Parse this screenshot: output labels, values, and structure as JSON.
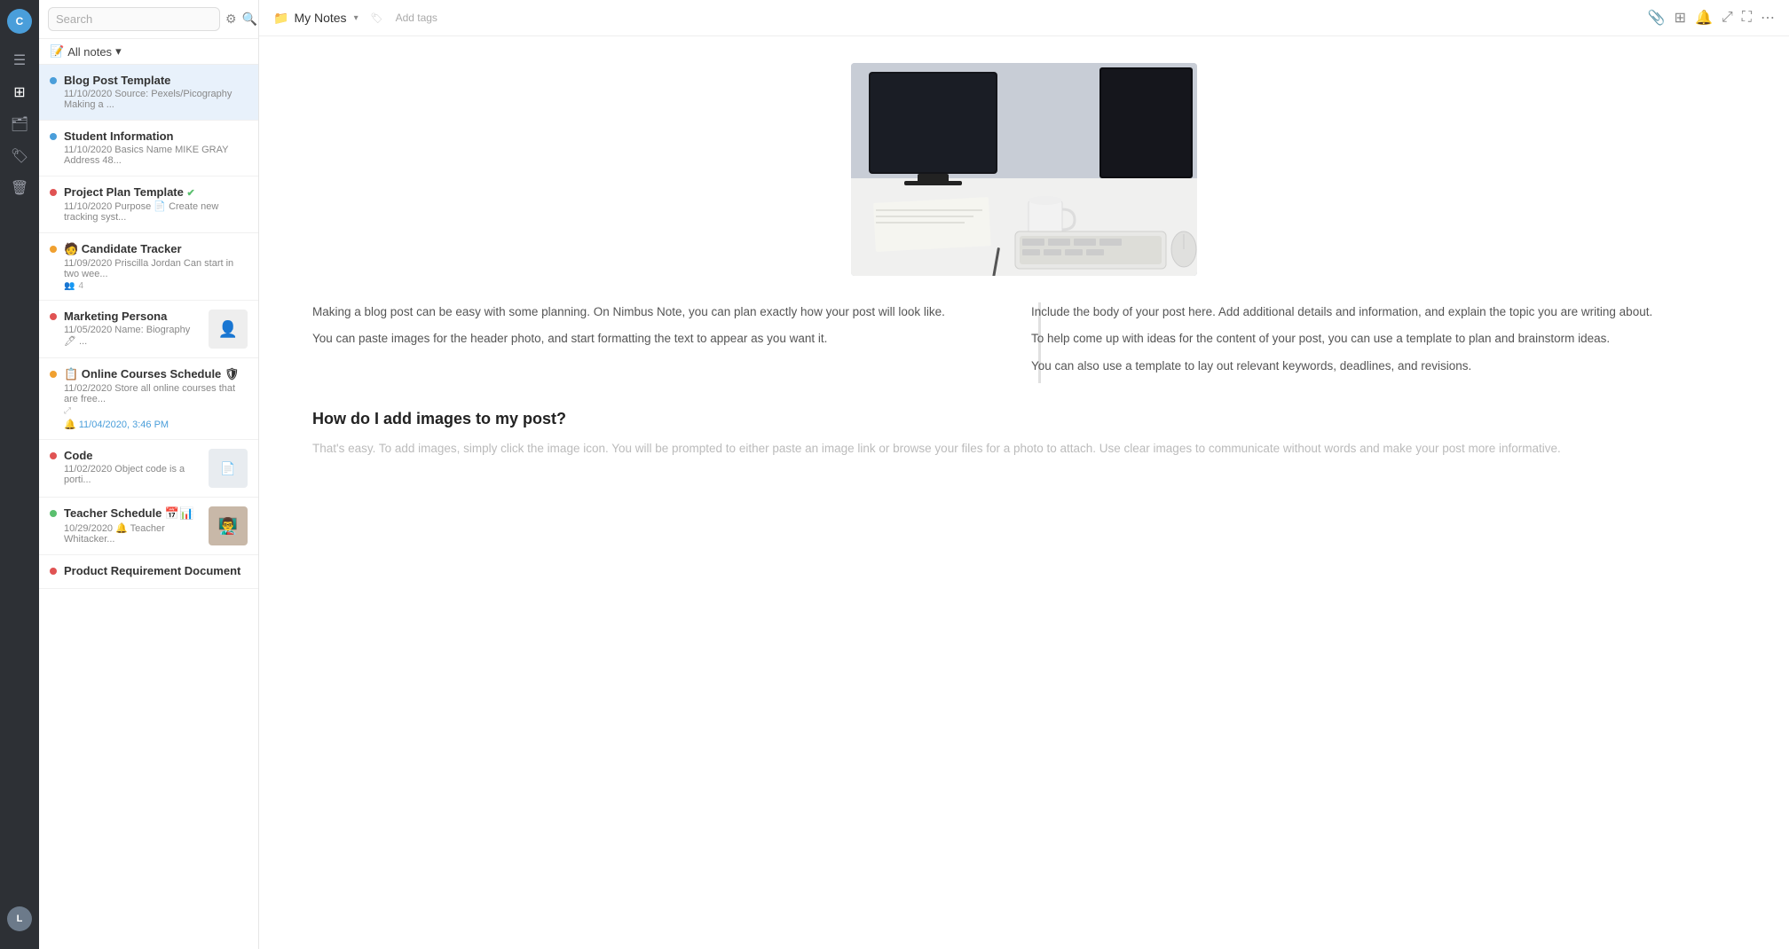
{
  "sidebar": {
    "avatar_top": "C",
    "avatar_bottom": "L",
    "icons": [
      {
        "name": "menu-icon",
        "symbol": "☰"
      },
      {
        "name": "grid-icon",
        "symbol": "⊞"
      },
      {
        "name": "folder-icon",
        "symbol": "📁"
      },
      {
        "name": "tag-icon",
        "symbol": "🏷"
      },
      {
        "name": "trash-icon",
        "symbol": "🗑"
      }
    ]
  },
  "notes_panel": {
    "search_placeholder": "Search",
    "filter_label": "All notes",
    "add_button": "+",
    "notes": [
      {
        "id": "blog-post",
        "title": "Blog Post Template",
        "date": "11/10/2020",
        "preview": "Source: Pexels/Picography Making a ...",
        "dot_color": "blue",
        "active": true,
        "has_thumb": false
      },
      {
        "id": "student-info",
        "title": "Student Information",
        "date": "11/10/2020",
        "preview": "Basics Name MIKE GRAY Address 48...",
        "dot_color": "blue",
        "active": false,
        "has_thumb": false
      },
      {
        "id": "project-plan",
        "title": "Project Plan Template ✔",
        "date": "11/10/2020",
        "preview": "Purpose 📄 Create new tracking syst...",
        "dot_color": "red",
        "active": false,
        "has_thumb": false
      },
      {
        "id": "candidate-tracker",
        "title": "Candidate Tracker",
        "date": "11/09/2020",
        "preview": "Priscilla Jordan Can start in two wee...",
        "dot_color": "orange",
        "active": false,
        "has_thumb": false,
        "icons": [
          "👥",
          "4"
        ]
      },
      {
        "id": "marketing-persona",
        "title": "Marketing Persona",
        "date": "11/05/2020",
        "preview": "Name: Biography 🖊 ...",
        "dot_color": "red",
        "active": false,
        "has_thumb": true
      },
      {
        "id": "online-courses",
        "title": "Online Courses Schedule 🛡",
        "date": "11/02/2020",
        "preview": "Store all online courses that are free...",
        "dot_color": "orange",
        "active": false,
        "has_thumb": false,
        "reminder": "🔔 11/04/2020, 3:46 PM",
        "has_share": true
      },
      {
        "id": "code",
        "title": "Code",
        "date": "11/02/2020",
        "preview": "Object code is a porti...",
        "dot_color": "red",
        "active": false,
        "has_thumb": true
      },
      {
        "id": "teacher-schedule",
        "title": "Teacher Schedule 📅📊",
        "date": "10/29/2020",
        "preview": "🔔 Teacher Whitacker...",
        "dot_color": "green",
        "active": false,
        "has_thumb": true
      },
      {
        "id": "product-req",
        "title": "Product Requirement Document",
        "date": "",
        "preview": "",
        "dot_color": "red",
        "active": false,
        "has_thumb": false
      }
    ]
  },
  "toolbar": {
    "notebook_icon": "📁",
    "notebook_name": "My Notes",
    "add_tags_label": "Add tags",
    "icons": [
      "📎",
      "⊞",
      "🔔",
      "⤢",
      "⋯"
    ],
    "icon_names": [
      "attachment-icon",
      "layout-icon",
      "notification-icon",
      "share-icon",
      "expand-icon",
      "more-icon"
    ]
  },
  "content": {
    "col1": {
      "para1": "Making a blog post can be easy with some planning. On Nimbus Note, you can plan exactly how your post will look like.",
      "para2": "You can paste images for the header photo, and start formatting the text to appear as you want it."
    },
    "col2": {
      "para1": "Include the body of your post here. Add additional details and information, and explain the topic you are writing about.",
      "para2": "To help come up with ideas for the content of your post, you can use a template to plan and brainstorm ideas.",
      "para3": "You can also use a template to lay out relevant keywords, deadlines, and revisions."
    },
    "images_section_heading": "How do I add images to my post?",
    "images_section_body": "That's easy. To add images, simply click the image icon. You will be prompted to either paste an image link or browse your files for a photo to attach. Use clear images to communicate without words and make your post more informative."
  }
}
